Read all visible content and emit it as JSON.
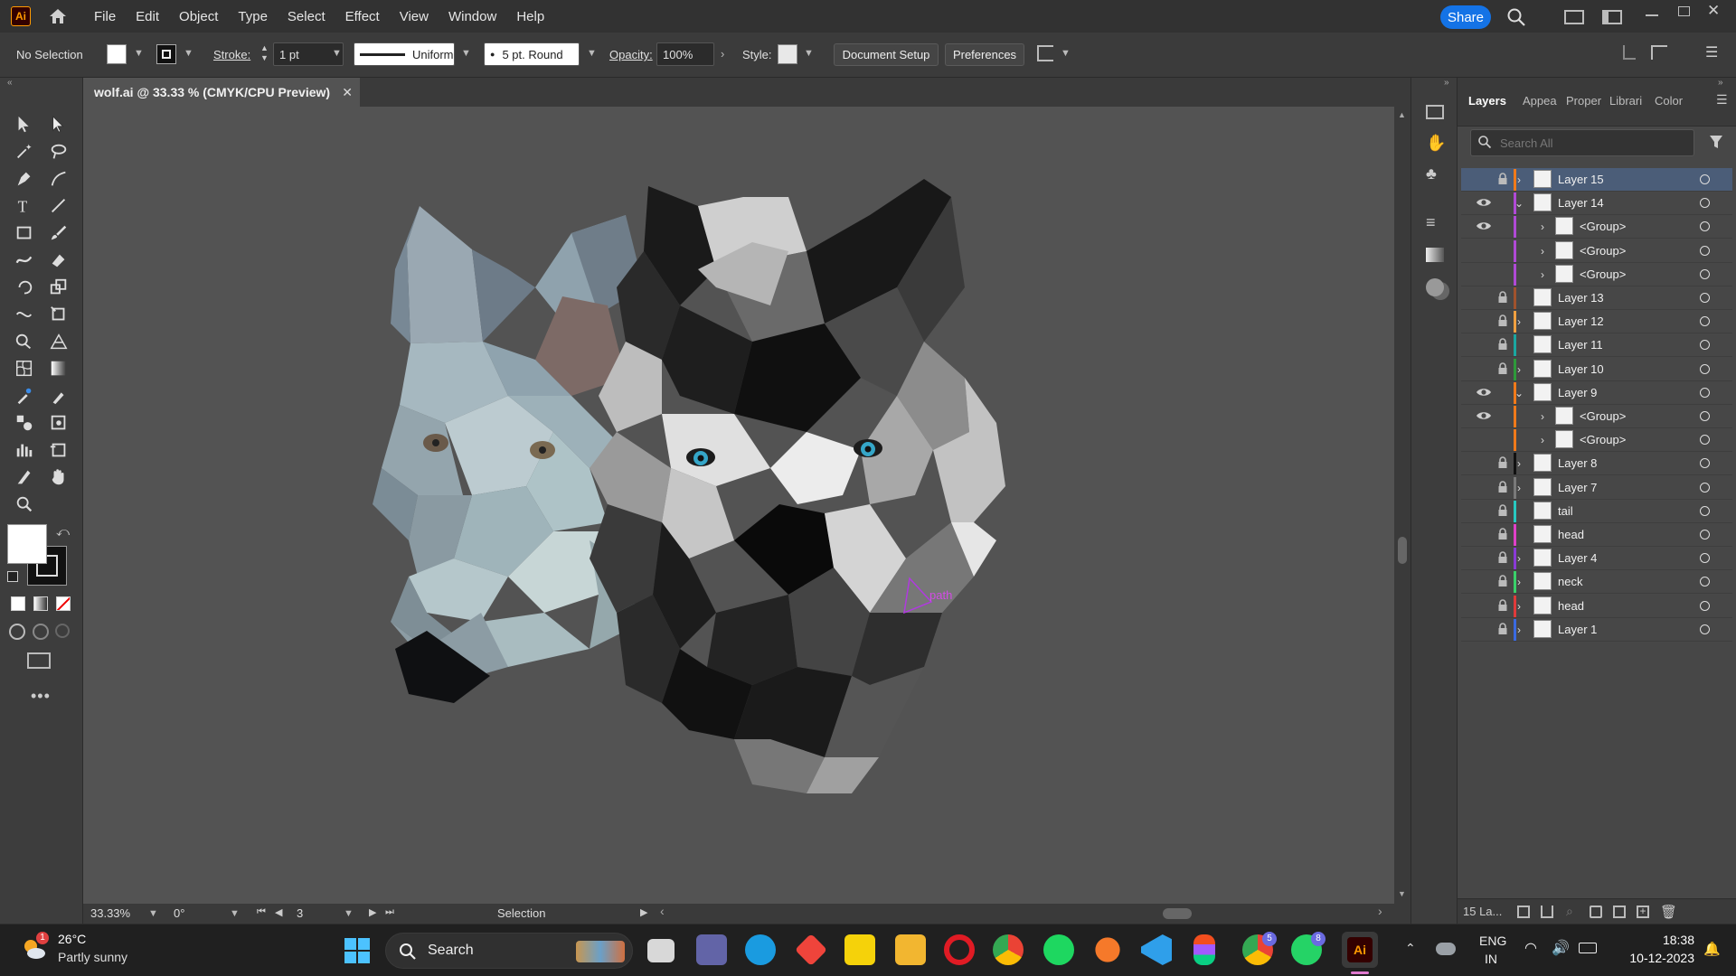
{
  "app": {
    "logo": "Ai",
    "menus": [
      "File",
      "Edit",
      "Object",
      "Type",
      "Select",
      "Effect",
      "View",
      "Window",
      "Help"
    ],
    "share_label": "Share"
  },
  "control_bar": {
    "selection_text": "No Selection",
    "stroke_label": "Stroke:",
    "stroke_value": "1 pt",
    "stroke_profile": "Uniform",
    "brush": "5 pt. Round",
    "opacity_label": "Opacity:",
    "opacity_value": "100%",
    "style_label": "Style:",
    "doc_setup_label": "Document Setup",
    "preferences_label": "Preferences"
  },
  "document": {
    "tab_title": "wolf.ai @ 33.33 % (CMYK/CPU Preview)",
    "close": "✕"
  },
  "canvas": {
    "path_label": "path"
  },
  "status": {
    "zoom": "33.33%",
    "rotation": "0°",
    "artboard": "3",
    "tool": "Selection"
  },
  "layers_panel": {
    "tabs": [
      "Layers",
      "Appea",
      "Proper",
      "Librari",
      "Color"
    ],
    "search_placeholder": "Search All",
    "layers": [
      {
        "name": "Layer 15",
        "visible": false,
        "locked": true,
        "expandable": true,
        "expanded": false,
        "indent": 0,
        "color": "#f07a1a",
        "selected": true
      },
      {
        "name": "Layer 14",
        "visible": true,
        "locked": false,
        "expandable": true,
        "expanded": true,
        "indent": 0,
        "color": "#b04ad6"
      },
      {
        "name": "<Group>",
        "visible": true,
        "locked": false,
        "expandable": true,
        "expanded": false,
        "indent": 1,
        "color": "#b04ad6"
      },
      {
        "name": "<Group>",
        "visible": false,
        "locked": false,
        "expandable": true,
        "expanded": false,
        "indent": 1,
        "color": "#b04ad6"
      },
      {
        "name": "<Group>",
        "visible": false,
        "locked": false,
        "expandable": true,
        "expanded": false,
        "indent": 1,
        "color": "#b04ad6"
      },
      {
        "name": "Layer 13",
        "visible": false,
        "locked": true,
        "expandable": false,
        "expanded": false,
        "indent": 0,
        "color": "#a0522d"
      },
      {
        "name": "Layer 12",
        "visible": false,
        "locked": true,
        "expandable": true,
        "expanded": false,
        "indent": 0,
        "color": "#f0a040"
      },
      {
        "name": "Layer 11",
        "visible": false,
        "locked": true,
        "expandable": false,
        "expanded": false,
        "indent": 0,
        "color": "#1aa7a0"
      },
      {
        "name": "Layer 10",
        "visible": false,
        "locked": true,
        "expandable": true,
        "expanded": false,
        "indent": 0,
        "color": "#2e9a3a"
      },
      {
        "name": "Layer 9",
        "visible": true,
        "locked": false,
        "expandable": true,
        "expanded": true,
        "indent": 0,
        "color": "#f07a1a"
      },
      {
        "name": "<Group>",
        "visible": true,
        "locked": false,
        "expandable": true,
        "expanded": false,
        "indent": 1,
        "color": "#f07a1a"
      },
      {
        "name": "<Group>",
        "visible": false,
        "locked": false,
        "expandable": true,
        "expanded": false,
        "indent": 1,
        "color": "#f07a1a"
      },
      {
        "name": "Layer 8",
        "visible": false,
        "locked": true,
        "expandable": true,
        "expanded": false,
        "indent": 0,
        "color": "#111111"
      },
      {
        "name": "Layer 7",
        "visible": false,
        "locked": true,
        "expandable": true,
        "expanded": false,
        "indent": 0,
        "color": "#7a7a7a"
      },
      {
        "name": "tail",
        "visible": false,
        "locked": true,
        "expandable": false,
        "expanded": false,
        "indent": 0,
        "color": "#28c8c0"
      },
      {
        "name": "head",
        "visible": false,
        "locked": true,
        "expandable": false,
        "expanded": false,
        "indent": 0,
        "color": "#e040c8"
      },
      {
        "name": "Layer 4",
        "visible": false,
        "locked": true,
        "expandable": true,
        "expanded": false,
        "indent": 0,
        "color": "#8a3ad6"
      },
      {
        "name": "neck",
        "visible": false,
        "locked": true,
        "expandable": true,
        "expanded": false,
        "indent": 0,
        "color": "#3ad06a"
      },
      {
        "name": "head",
        "visible": false,
        "locked": true,
        "expandable": true,
        "expanded": false,
        "indent": 0,
        "color": "#e03a3a"
      },
      {
        "name": "Layer 1",
        "visible": false,
        "locked": true,
        "expandable": true,
        "expanded": false,
        "indent": 0,
        "color": "#3a6ae0"
      }
    ],
    "footer_count": "15 La..."
  },
  "taskbar": {
    "weather_temp": "26°C",
    "weather_desc": "Partly sunny",
    "weather_badge": "1",
    "search_label": "Search",
    "lang_top": "ENG",
    "lang_bottom": "IN",
    "time": "18:38",
    "date": "10-12-2023",
    "chrome_badge": "5",
    "whatsapp_badge": "8",
    "illustrator_label": "Ai"
  }
}
